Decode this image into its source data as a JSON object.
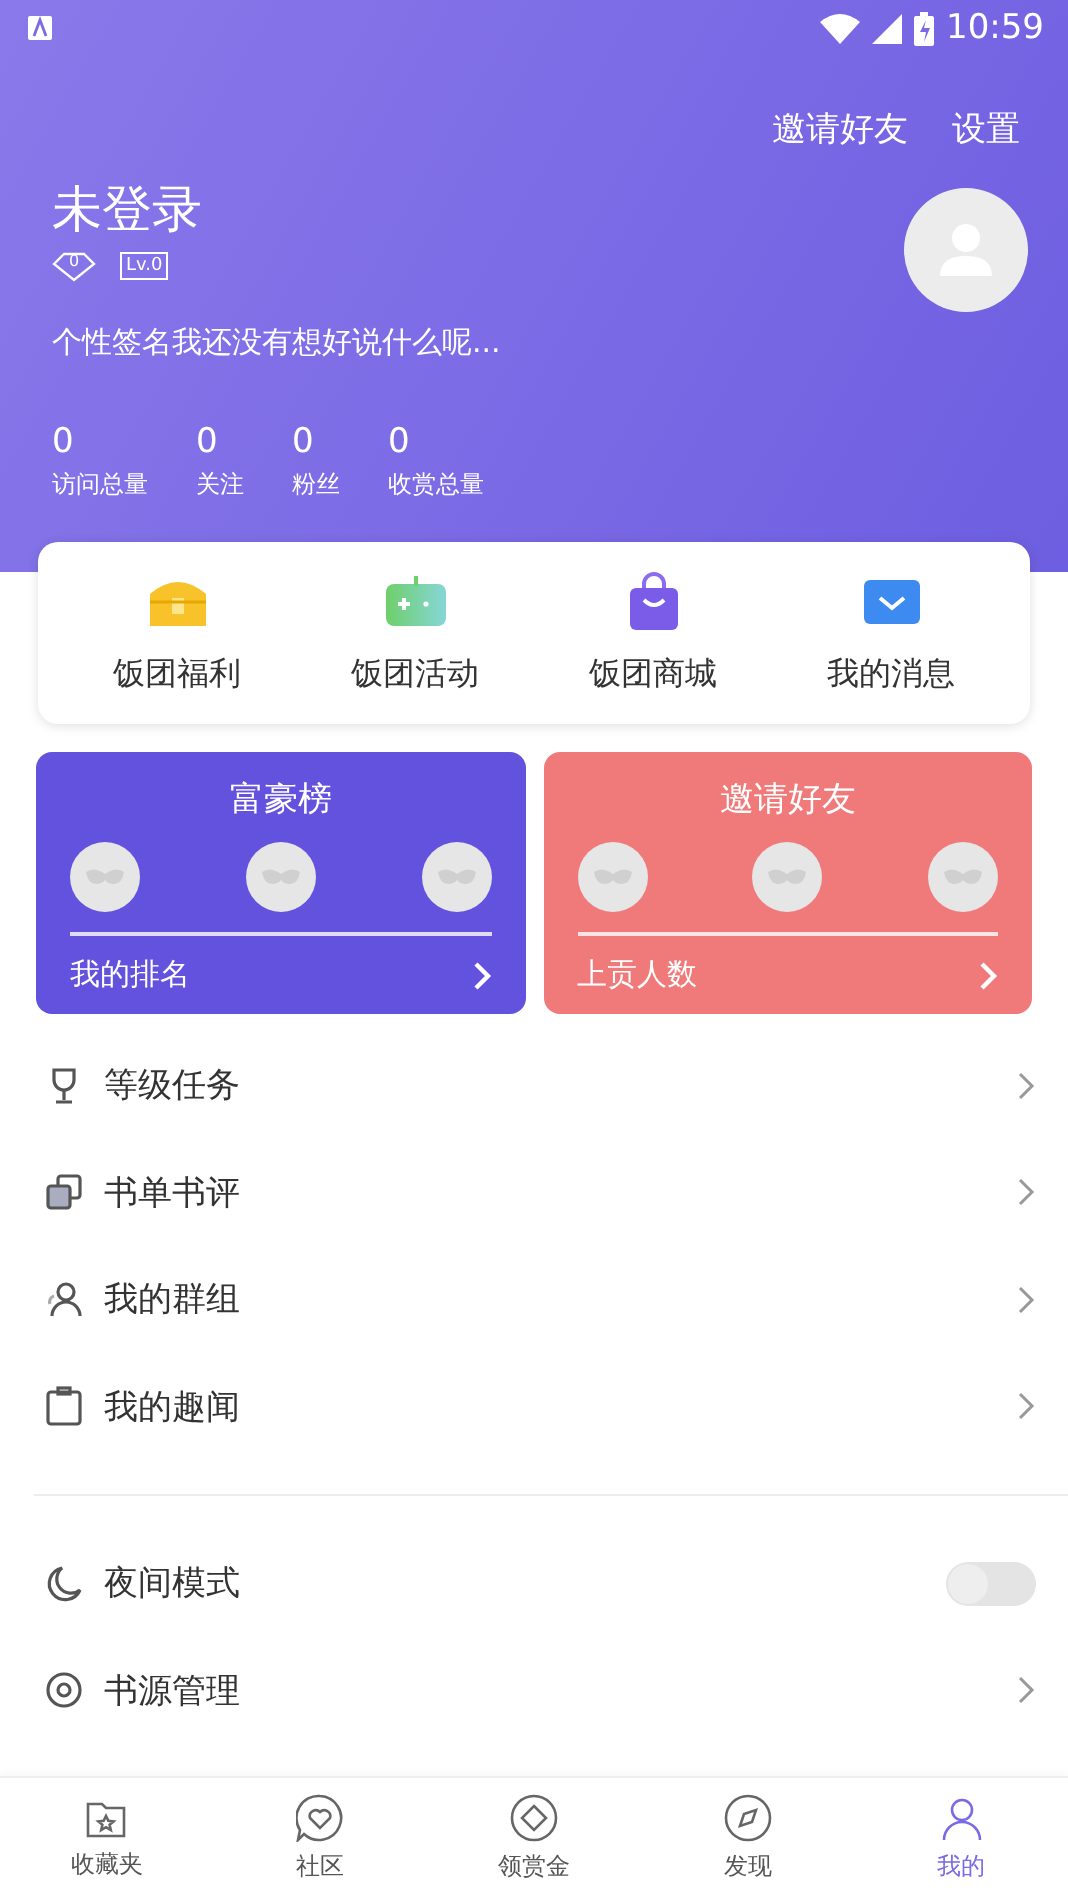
{
  "status_bar": {
    "time": "10:59"
  },
  "header": {
    "actions": [
      "邀请好友",
      "设置"
    ],
    "username": "未登录",
    "diamond_count": "0",
    "level": "Lv.0",
    "signature": "个性签名我还没有想好说什么呢...",
    "stats": [
      {
        "value": "0",
        "label": "访问总量"
      },
      {
        "value": "0",
        "label": "关注"
      },
      {
        "value": "0",
        "label": "粉丝"
      },
      {
        "value": "0",
        "label": "收赏总量"
      }
    ]
  },
  "shortcuts": [
    {
      "label": "饭团福利"
    },
    {
      "label": "饭团活动"
    },
    {
      "label": "饭团商城"
    },
    {
      "label": "我的消息"
    }
  ],
  "boards": [
    {
      "title": "富豪榜",
      "footer": "我的排名",
      "color": "#6352dd"
    },
    {
      "title": "邀请好友",
      "footer": "上贡人数",
      "color": "#f07a7a"
    }
  ],
  "menu": [
    {
      "label": "等级任务",
      "kind": "link"
    },
    {
      "label": "书单书评",
      "kind": "link"
    },
    {
      "label": "我的群组",
      "kind": "link"
    },
    {
      "label": "我的趣闻",
      "kind": "link"
    }
  ],
  "settings": [
    {
      "label": "夜间模式",
      "kind": "toggle",
      "on": false
    },
    {
      "label": "书源管理",
      "kind": "link"
    }
  ],
  "tabs": [
    {
      "label": "收藏夹",
      "selected": false
    },
    {
      "label": "社区",
      "selected": false
    },
    {
      "label": "领赏金",
      "selected": false
    },
    {
      "label": "发现",
      "selected": false
    },
    {
      "label": "我的",
      "selected": true
    }
  ]
}
